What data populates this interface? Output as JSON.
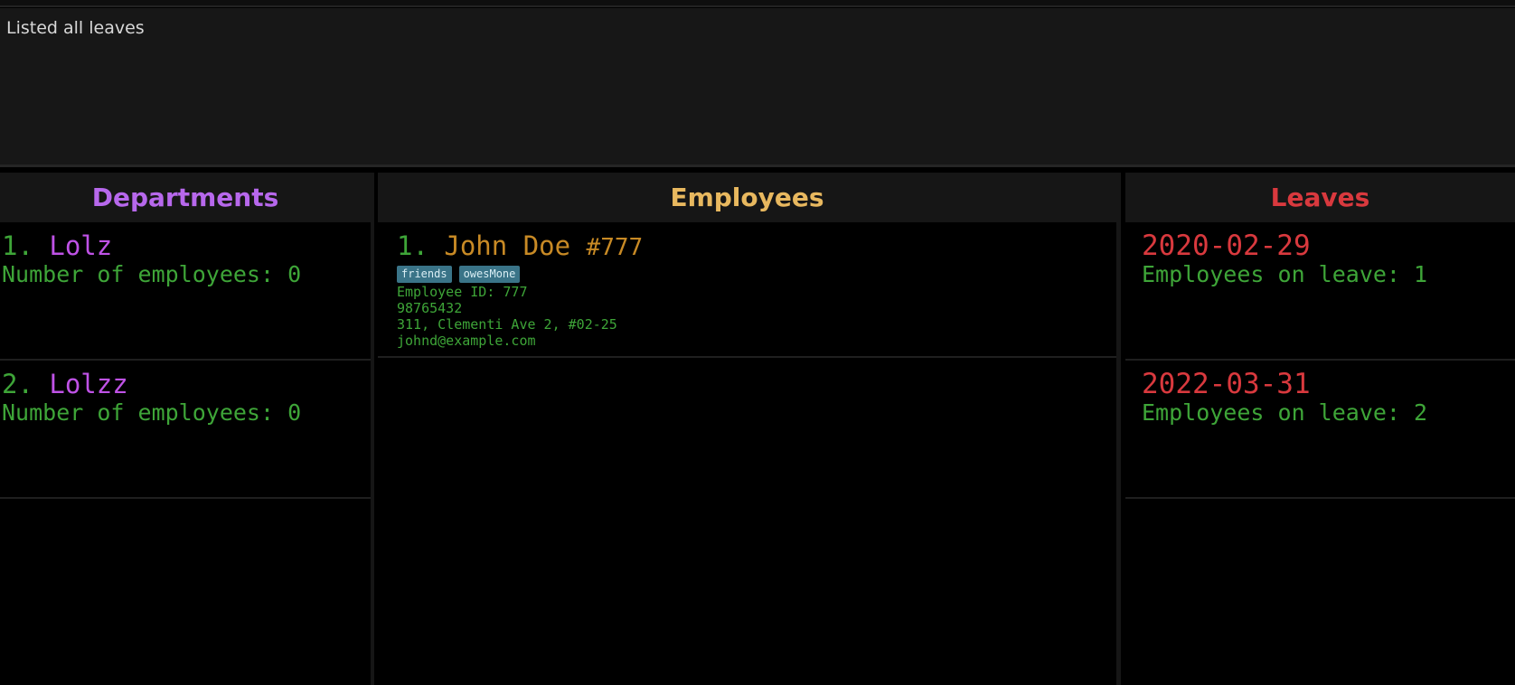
{
  "result_display": {
    "text": "Listed all leaves"
  },
  "departments": {
    "header": "Departments",
    "items": [
      {
        "index": "1.",
        "name": "Lolz",
        "count_label": "Number of employees: 0"
      },
      {
        "index": "2.",
        "name": "Lolzz",
        "count_label": "Number of employees: 0"
      }
    ]
  },
  "employees": {
    "header": "Employees",
    "items": [
      {
        "index": "1.",
        "name": "John Doe",
        "id_tag": "#777",
        "tags": [
          "friends",
          "owesMone"
        ],
        "employee_id": "Employee ID: 777",
        "phone": "98765432",
        "address": "311, Clementi Ave 2, #02-25",
        "email": "johnd@example.com"
      }
    ]
  },
  "leaves": {
    "header": "Leaves",
    "items": [
      {
        "date": "2020-02-29",
        "count_label": "Employees on leave: 1"
      },
      {
        "date": "2022-03-31",
        "count_label": "Employees on leave: 2"
      }
    ]
  },
  "colors": {
    "department_accent": "#b768ec",
    "employee_accent": "#e8b85f",
    "leave_accent": "#d9393e",
    "detail_green": "#3ea538",
    "tag_bg": "#3a7488"
  }
}
